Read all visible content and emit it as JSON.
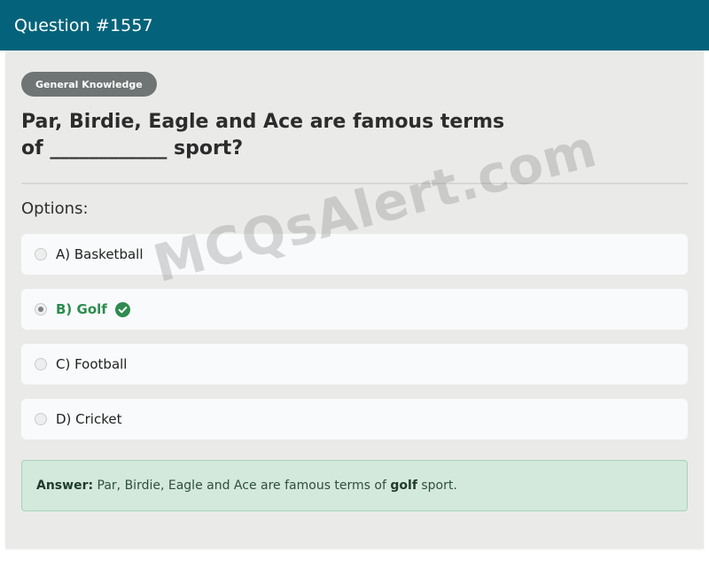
{
  "header": {
    "title": "Question #1557"
  },
  "question": {
    "category": "General Knowledge",
    "text": "Par, Birdie, Eagle and Ace are famous terms of ____________ sport?"
  },
  "options_label": "Options:",
  "options": [
    {
      "label": "A) Basketball",
      "selected": false,
      "correct": false
    },
    {
      "label": "B) Golf",
      "selected": true,
      "correct": true
    },
    {
      "label": "C) Football",
      "selected": false,
      "correct": false
    },
    {
      "label": "D) Cricket",
      "selected": false,
      "correct": false
    }
  ],
  "answer": {
    "prefix": "Answer:",
    "text_before": " Par, Birdie, Eagle and Ace are famous terms of ",
    "highlight": "golf",
    "text_after": " sport."
  },
  "watermark": "MCQsAlert.com",
  "colors": {
    "header_bg": "#04637a",
    "correct_green": "#2e8b4f",
    "answer_bg": "#d2e9dc"
  },
  "icons": {
    "correct": "check-circle-icon"
  }
}
